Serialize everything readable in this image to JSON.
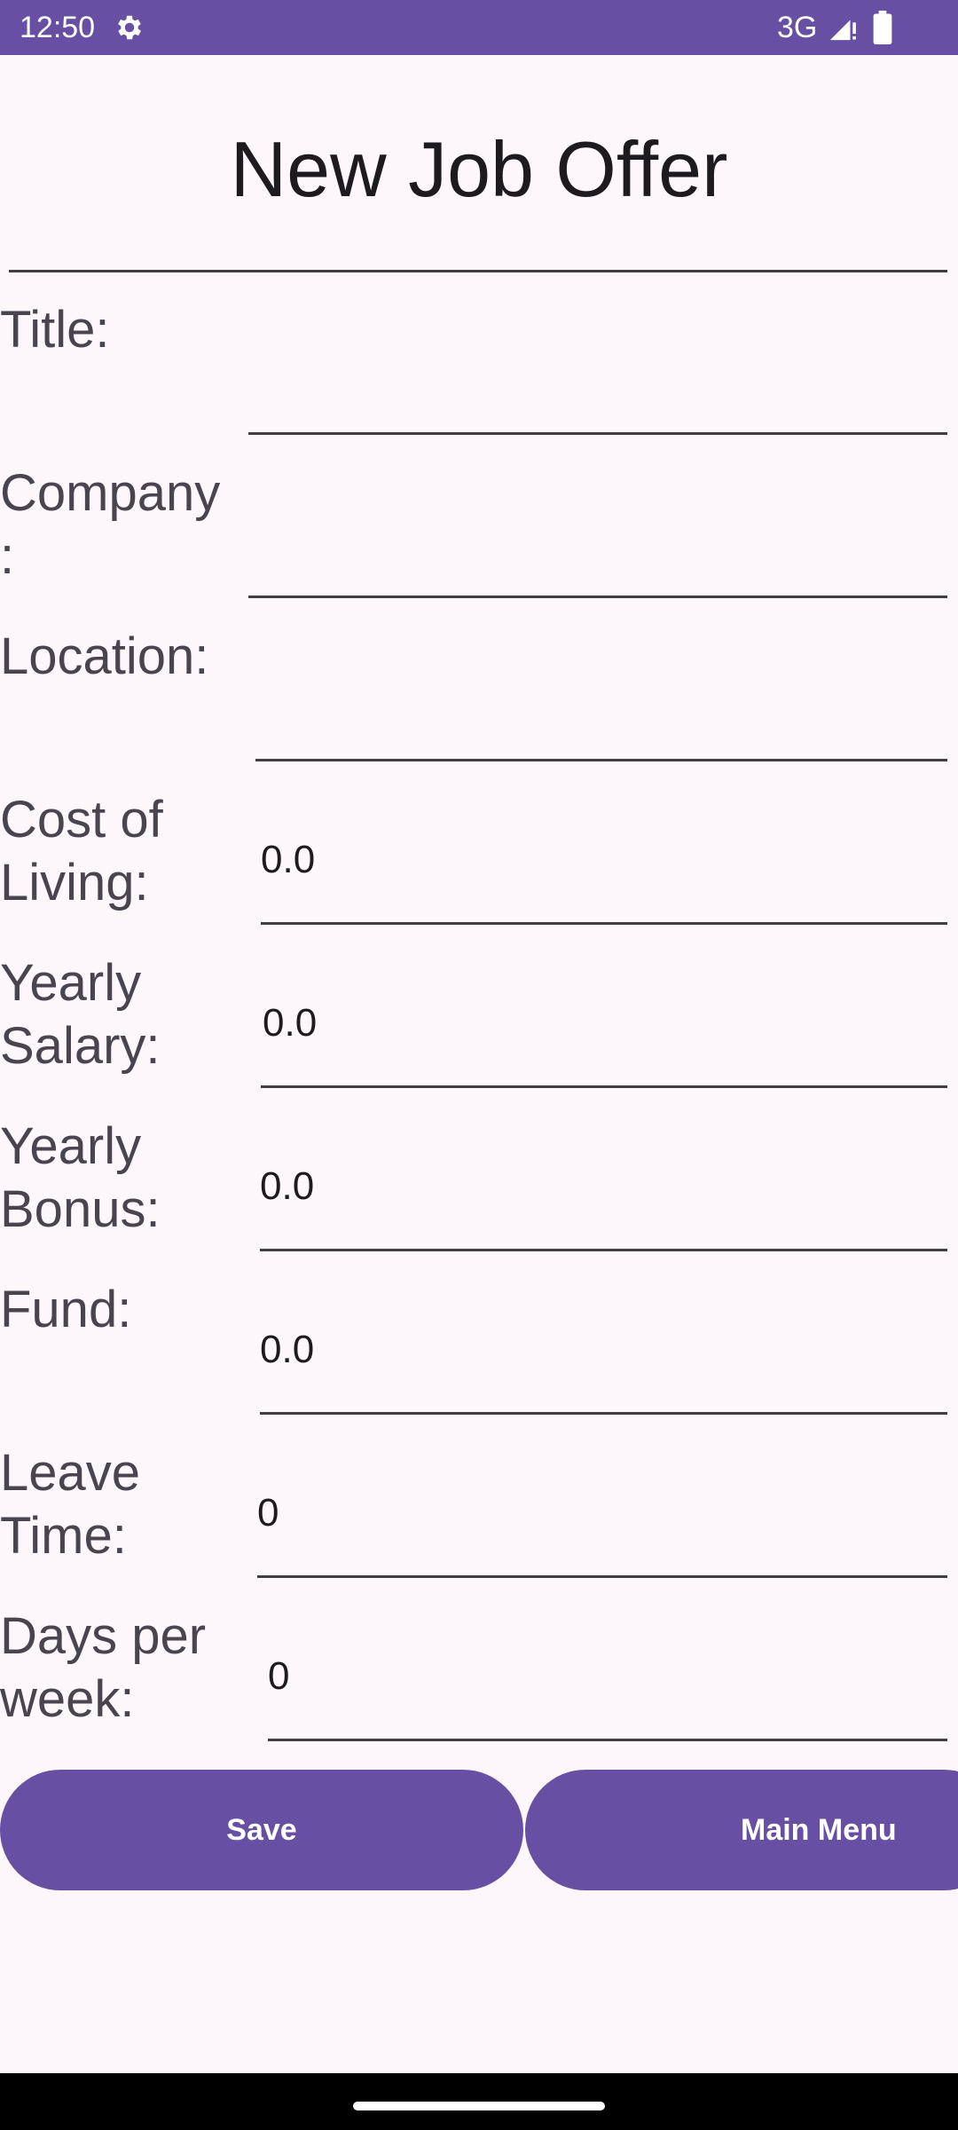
{
  "status_bar": {
    "time": "12:50",
    "network": "3G",
    "icons": [
      "gear-icon",
      "signal-icon",
      "battery-icon"
    ],
    "color": "#6750a4"
  },
  "page": {
    "title": "New Job Offer"
  },
  "form": {
    "title": {
      "label": "Title:",
      "value": ""
    },
    "company": {
      "label": "Company\n:",
      "value": ""
    },
    "location": {
      "label": "Location:",
      "value": ""
    },
    "cost_of_living": {
      "label": "Cost of Living:",
      "value": "0.0"
    },
    "yearly_salary": {
      "label": "Yearly Salary:",
      "value": "0.0"
    },
    "yearly_bonus": {
      "label": "Yearly Bonus:",
      "value": "0.0"
    },
    "fund": {
      "label": "Fund:",
      "value": "0.0"
    },
    "leave_time": {
      "label": "Leave Time:",
      "value": "0"
    },
    "days_per_week": {
      "label": "Days per week:",
      "value": "0"
    }
  },
  "buttons": {
    "save": "Save",
    "main_menu": "Main Menu"
  },
  "colors": {
    "accent": "#6750a4",
    "background": "#fdf7fc"
  }
}
